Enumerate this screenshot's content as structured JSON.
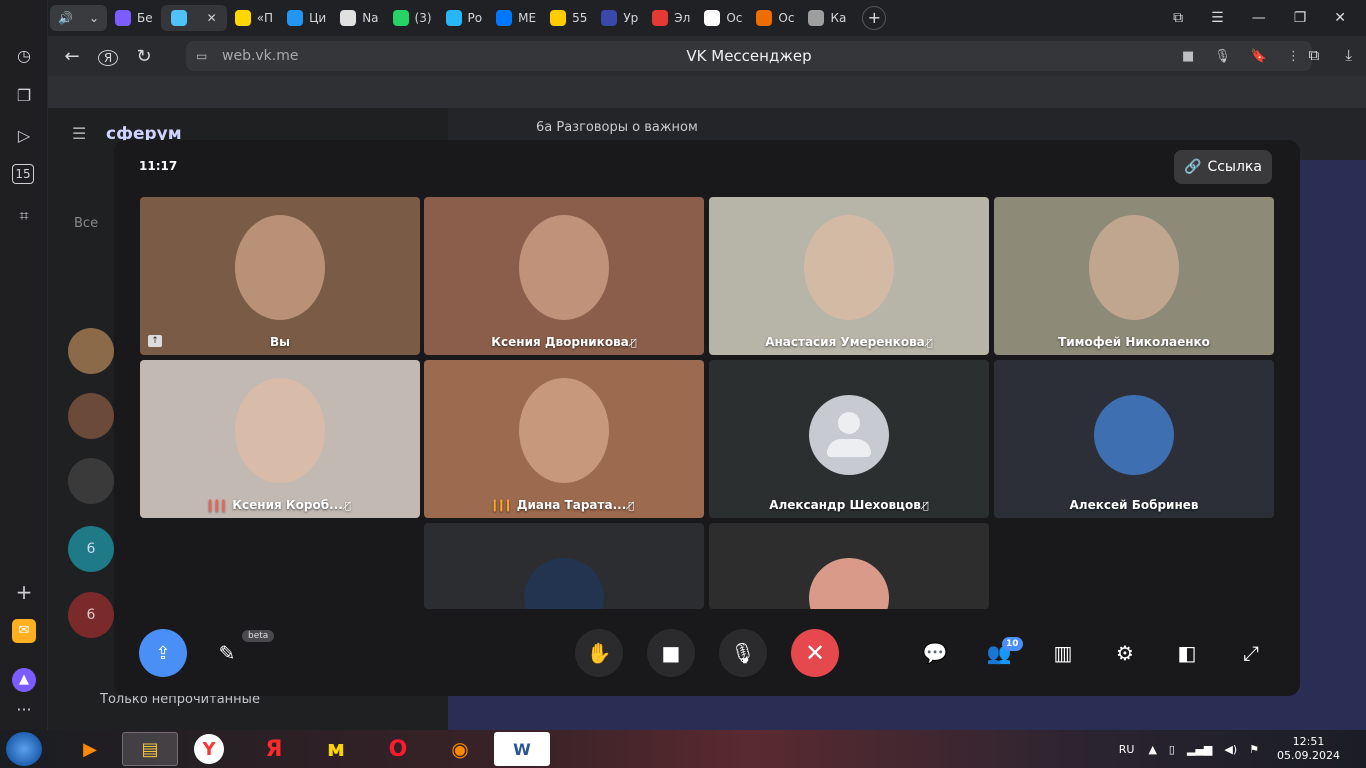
{
  "browser": {
    "tabs": [
      {
        "label": "Бе",
        "color": "#7b5cff"
      },
      {
        "label": "",
        "color": "#4fc3f7",
        "active": true
      },
      {
        "label": "«П",
        "color": "#ffd600"
      },
      {
        "label": "Ци",
        "color": "#2196f3"
      },
      {
        "label": "Na",
        "color": "#e0e0e0"
      },
      {
        "label": "(3)",
        "color": "#25d366"
      },
      {
        "label": "Ро",
        "color": "#29b6f6"
      },
      {
        "label": "МЕ",
        "color": "#0077ff"
      },
      {
        "label": "55",
        "color": "#ffcc00"
      },
      {
        "label": "Ур",
        "color": "#3949ab"
      },
      {
        "label": "Эл",
        "color": "#e53935"
      },
      {
        "label": "Ос",
        "color": "#ffffff"
      },
      {
        "label": "Ос",
        "color": "#ef6c00"
      },
      {
        "label": "Ка",
        "color": "#9e9e9e"
      }
    ],
    "url": "web.vk.me",
    "page_title": "VK Мессенджер",
    "yandex_label": "Я"
  },
  "vk": {
    "logo": "сферум",
    "chat_title": "6а Разговоры о важном",
    "filter_all": "Все",
    "only_unread": "Только непрочитанные",
    "avatar_number": "6"
  },
  "call": {
    "time": "11:17",
    "link_label": "Ссылка",
    "participants": [
      {
        "name": "Вы",
        "bg": "#7a5b45"
      },
      {
        "name": "Ксения Дворникова",
        "bg": "#8a5e4b",
        "muted": true
      },
      {
        "name": "Анастасия Умеренкова",
        "bg": "#b7b5a8",
        "muted": true
      },
      {
        "name": "Тимофей Николаенко",
        "bg": "#8d8a78"
      },
      {
        "name": "Ксения Короб...",
        "bg": "#c2b9b3",
        "muted": true,
        "speaking_color": "#ff5a4e"
      },
      {
        "name": "Диана Тарата...",
        "bg": "#9c6a4e",
        "muted": true,
        "speaking_color": "#ffa726"
      },
      {
        "name": "Александр Шеховцов",
        "bg": "#2c2f30",
        "muted": true
      },
      {
        "name": "Алексей Бобринев",
        "bg": "#2c2f38"
      },
      {
        "name": "",
        "bg": "#2c2d31"
      },
      {
        "name": "",
        "bg": "#2c2d2c"
      }
    ],
    "controls": {
      "beta_label": "beta",
      "participants_count": "10"
    },
    "colors": {
      "end_call": "#e5484d",
      "share": "#4a8ff5"
    }
  },
  "taskbar": {
    "lang": "RU",
    "time": "12:51",
    "date": "05.09.2024"
  }
}
